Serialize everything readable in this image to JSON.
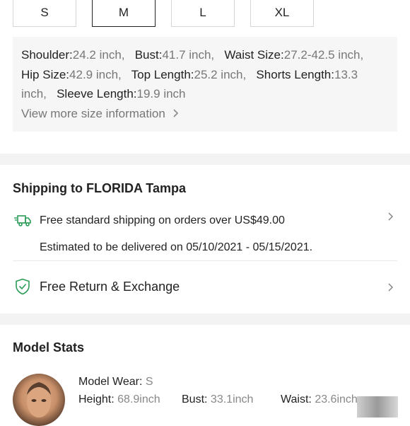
{
  "sizes": {
    "items": [
      "S",
      "M",
      "L",
      "XL"
    ],
    "selected": "M"
  },
  "measurements": {
    "shoulder_label": "Shoulder:",
    "shoulder_value": "24.2 inch,",
    "bust_label": "Bust:",
    "bust_value": "41.7 inch,",
    "waist_label": "Waist Size:",
    "waist_value": "27.2-42.5 inch,",
    "hip_label": "Hip Size:",
    "hip_value": "42.9 inch,",
    "top_label": "Top Length:",
    "top_value": "25.2 inch,",
    "shorts_label": "Shorts Length:",
    "shorts_value": "13.3 inch,",
    "sleeve_label": "Sleeve Length:",
    "sleeve_value": "19.9 inch",
    "more_link": "View more size information"
  },
  "shipping": {
    "title": "Shipping to FLORIDA Tampa",
    "free_shipping": "Free standard shipping on orders over US$49.00",
    "estimate": "Estimated to be delivered on 05/10/2021 - 05/15/2021.",
    "return_label": "Free Return & Exchange"
  },
  "model": {
    "title": "Model Stats",
    "wear_label": "Model Wear:",
    "wear_value": "S",
    "height_label": "Height:",
    "height_value": "68.9inch",
    "bust_label": "Bust:",
    "bust_value": "33.1inch",
    "waist_label": "Waist:",
    "waist_value": "23.6inch"
  },
  "colors": {
    "accent_green": "#2a9d57",
    "divider_gray": "#f3f3f3"
  }
}
